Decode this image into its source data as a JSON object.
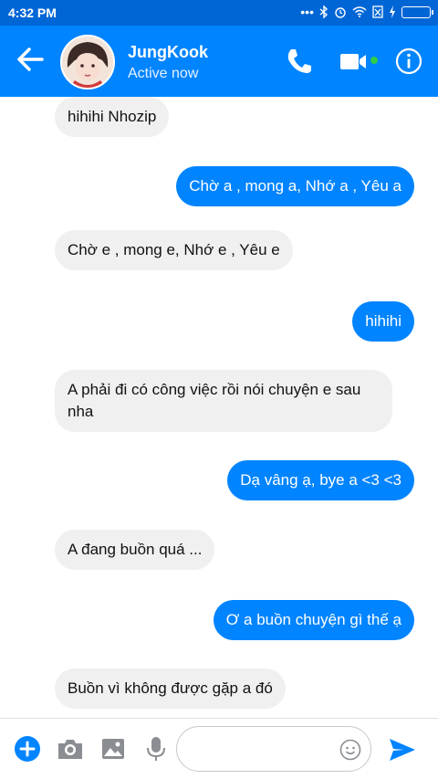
{
  "status_bar": {
    "time": "4:32 PM",
    "icons": [
      "dots-icon",
      "bluetooth-icon",
      "alarm-icon",
      "wifi-icon",
      "sim-icon",
      "charging-icon",
      "battery-icon"
    ]
  },
  "header": {
    "contact_name": "JungKook",
    "contact_status": "Active now",
    "icons": [
      "back-arrow-icon",
      "phone-icon",
      "video-icon",
      "info-icon"
    ]
  },
  "messages": [
    {
      "side": "in",
      "text": "hihihi Nhozip"
    },
    {
      "side": "out",
      "text": "Chờ a , mong a, Nhớ a , Yêu a"
    },
    {
      "side": "in",
      "text": "Chờ e , mong e, Nhớ e , Yêu e"
    },
    {
      "side": "out",
      "text": "hihihi"
    },
    {
      "side": "in",
      "text": "A phải đi có công việc rồi nói chuyện e sau nha"
    },
    {
      "side": "out",
      "text": "Dạ vâng ạ, bye a <3 <3"
    },
    {
      "side": "in",
      "text": "A đang buồn quá ..."
    },
    {
      "side": "out",
      "text": "Ơ a buồn chuyện gì thế ạ"
    },
    {
      "side": "in",
      "text": "Buồn vì không được gặp a đó"
    }
  ],
  "composer": {
    "input_value": "",
    "input_placeholder": "",
    "icons": [
      "plus-icon",
      "camera-icon",
      "image-icon",
      "microphone-icon",
      "emoji-icon",
      "send-icon"
    ]
  },
  "colors": {
    "status_bar": "#0066d6",
    "header": "#0084ff",
    "outgoing_bubble": "#0084ff",
    "incoming_bubble": "#f0f0f0",
    "online_dot": "#31cc46"
  }
}
